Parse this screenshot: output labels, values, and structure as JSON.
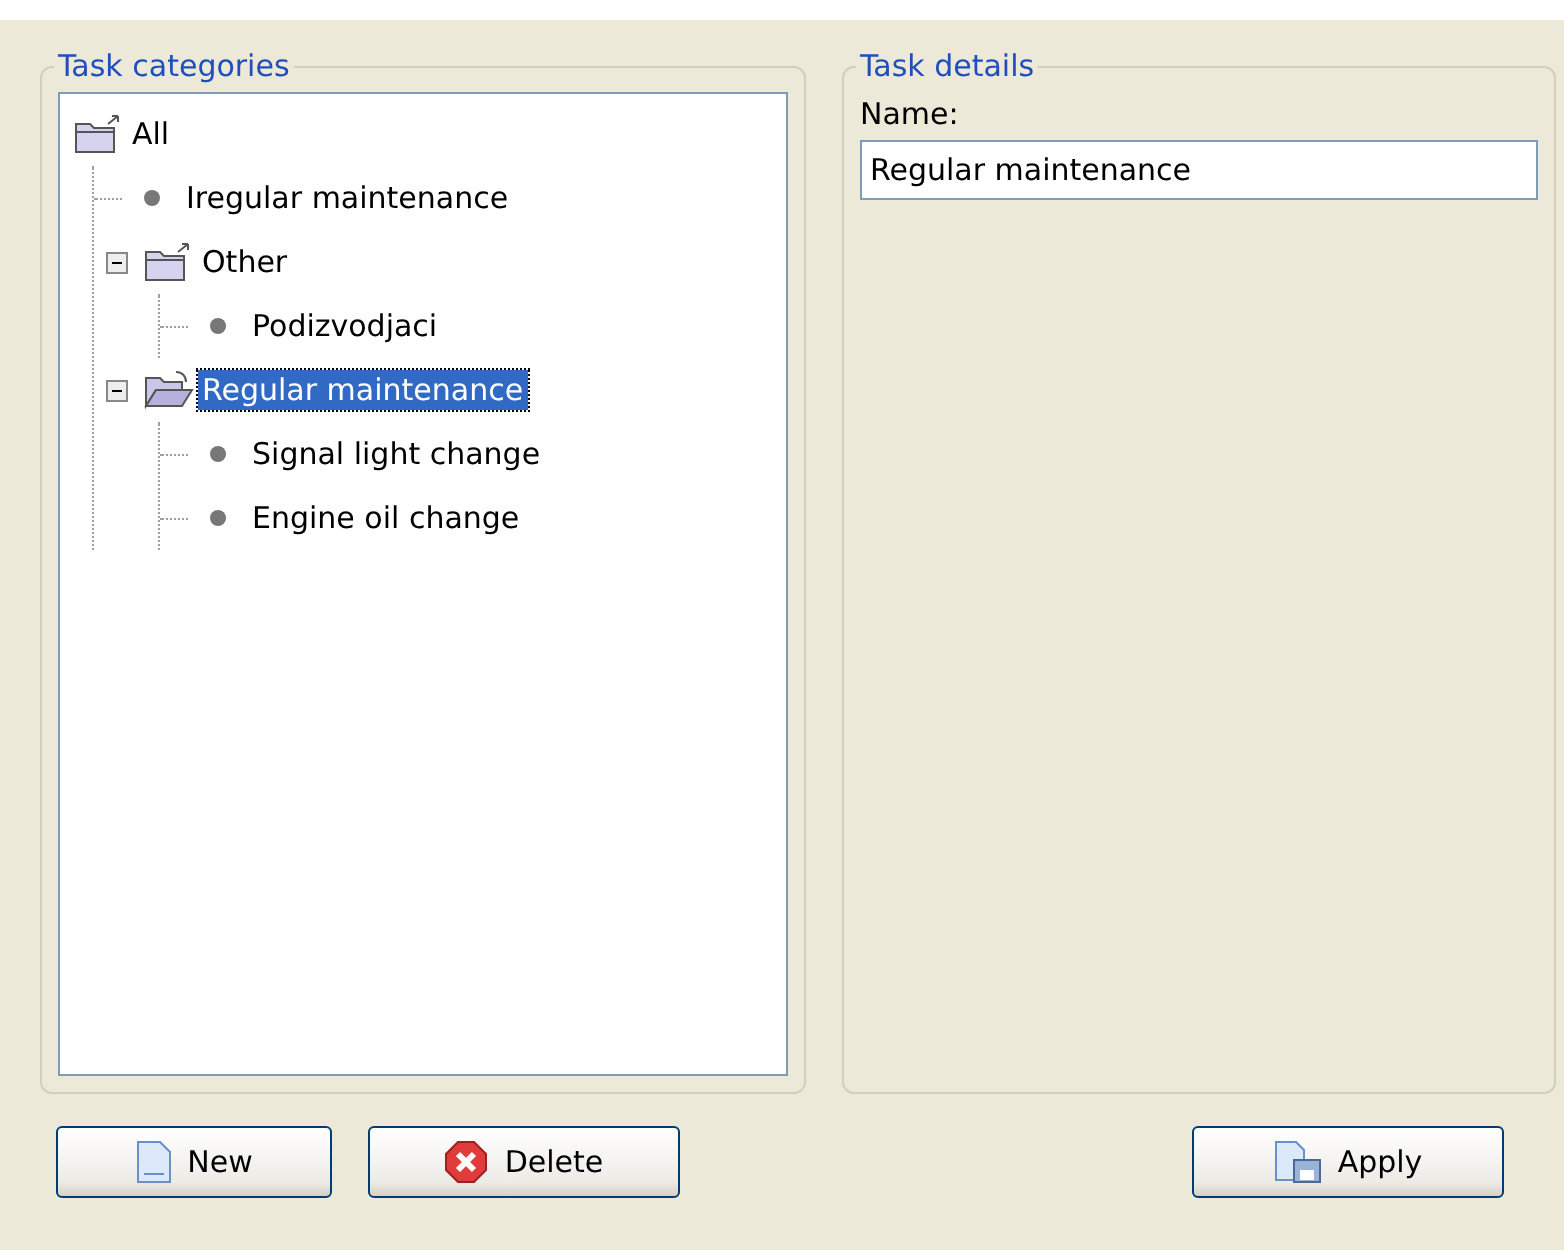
{
  "categories": {
    "title": "Task categories",
    "tree": [
      {
        "label": "All",
        "kind": "folder",
        "selected": false,
        "children": [
          {
            "label": "Iregular maintenance",
            "kind": "leaf",
            "selected": false
          },
          {
            "label": "Other",
            "kind": "folder",
            "expanded": true,
            "selected": false,
            "children": [
              {
                "label": "Podizvodjaci",
                "kind": "leaf",
                "selected": false
              }
            ]
          },
          {
            "label": "Regular maintenance",
            "kind": "folder",
            "expanded": true,
            "selected": true,
            "children": [
              {
                "label": "Signal light change",
                "kind": "leaf",
                "selected": false
              },
              {
                "label": "Engine oil change",
                "kind": "leaf",
                "selected": false
              }
            ]
          }
        ]
      }
    ]
  },
  "details": {
    "title": "Task details",
    "name_label": "Name:",
    "name_value": "Regular maintenance"
  },
  "buttons": [
    {
      "label": "New",
      "kind": "new"
    },
    {
      "label": "Delete",
      "kind": "delete"
    },
    {
      "label": "Apply",
      "kind": "apply"
    }
  ]
}
